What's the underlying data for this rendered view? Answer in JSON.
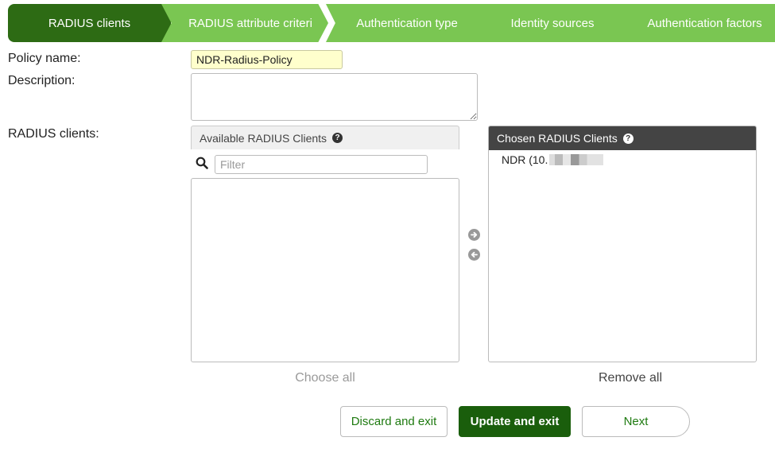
{
  "wizard": {
    "steps": [
      {
        "label": "RADIUS clients",
        "state": "active"
      },
      {
        "label": "RADIUS attribute criteri",
        "state": "pending"
      },
      {
        "label": "Authentication type",
        "state": "pending"
      },
      {
        "label": "Identity sources",
        "state": "pending"
      },
      {
        "label": "Authentication factors",
        "state": "pending"
      }
    ],
    "colors": {
      "active": "#2d6b14",
      "pending": "#7ac652"
    }
  },
  "form": {
    "policy_name_label": "Policy name:",
    "policy_name_value": "NDR-Radius-Policy",
    "description_label": "Description:",
    "description_value": "",
    "radius_clients_label": "RADIUS clients:"
  },
  "available": {
    "header": "Available RADIUS Clients",
    "filter_placeholder": "Filter",
    "filter_value": "",
    "items": [],
    "choose_all": "Choose all"
  },
  "chosen": {
    "header": "Chosen RADIUS Clients",
    "items": [
      "NDR (10."
    ],
    "remove_all": "Remove all"
  },
  "transfer": {
    "add_icon": "arrow-right-circle-icon",
    "remove_icon": "arrow-left-circle-icon"
  },
  "buttons": {
    "discard": "Discard and exit",
    "update": "Update and exit",
    "next": "Next"
  }
}
